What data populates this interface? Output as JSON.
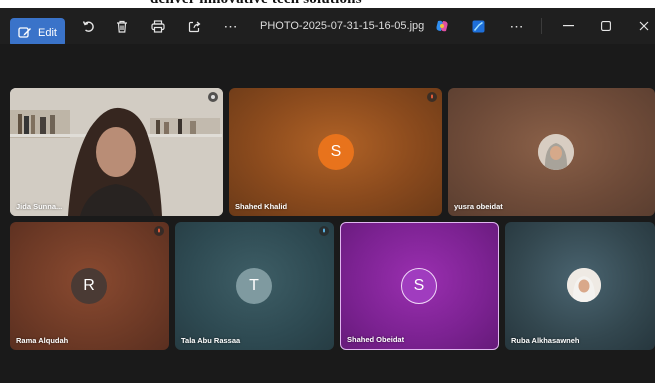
{
  "document_heading": "deliver innovative tech solutions",
  "toolbar": {
    "edit_label": "Edit",
    "filename": "PHOTO-2025-07-31-15-16-05.jpg",
    "icons": [
      "rotate-icon",
      "delete-icon",
      "print-icon",
      "share-icon",
      "more-icon",
      "copilot-icon",
      "designer-icon",
      "more-icon",
      "minimize-icon",
      "maximize-icon",
      "close-icon"
    ]
  },
  "participants": [
    {
      "name": "Jida Sunna...",
      "initial": "",
      "type": "video"
    },
    {
      "name": "Shahed Khalid",
      "initial": "S",
      "type": "initial",
      "avatar_color": "#e8731c"
    },
    {
      "name": "yusra obeidat",
      "initial": "",
      "type": "photo"
    },
    {
      "name": "Rama Alqudah",
      "initial": "R",
      "type": "initial",
      "avatar_color": "#4a3a34"
    },
    {
      "name": "Tala Abu Rassaa",
      "initial": "T",
      "type": "initial",
      "avatar_color": "#7f9aa0"
    },
    {
      "name": "Shahed Obeidat",
      "initial": "S",
      "type": "initial",
      "avatar_color": "#a03cbf",
      "active_speaker": true
    },
    {
      "name": "Ruba Alkhasawneh",
      "initial": "",
      "type": "photo"
    }
  ],
  "colors": {
    "accent": "#3a73c9",
    "active_border": "#e0b6f0"
  }
}
